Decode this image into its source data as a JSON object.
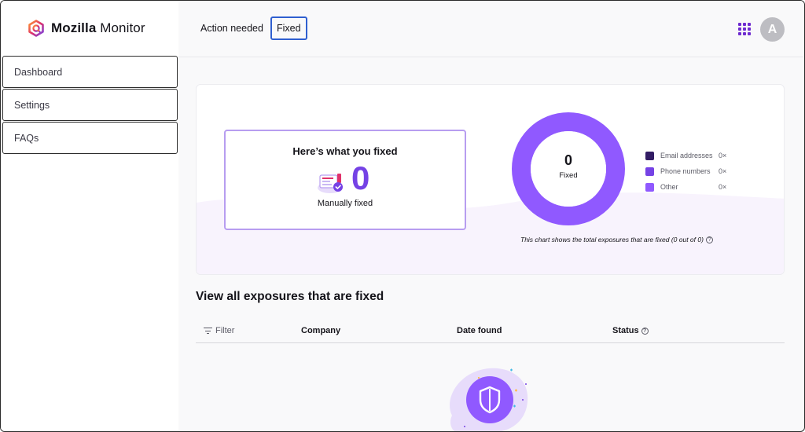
{
  "brand": {
    "name_bold": "Mozilla",
    "name_rest": " Monitor",
    "logo_icon": "mozilla-monitor-logo-icon"
  },
  "sidebar": {
    "items": [
      {
        "label": "Dashboard"
      },
      {
        "label": "Settings"
      },
      {
        "label": "FAQs"
      }
    ]
  },
  "header": {
    "tabs": [
      {
        "label": "Action needed",
        "selected": false
      },
      {
        "label": "Fixed",
        "selected": true
      }
    ],
    "apps_icon": "grid-apps-icon",
    "avatar_initial": "A"
  },
  "summary": {
    "title": "Here’s what you fixed",
    "count": "0",
    "count_label": "Manually fixed",
    "donut": {
      "value": "0",
      "label": "Fixed",
      "color": "#9059ff"
    },
    "legend": [
      {
        "label": "Email addresses",
        "count": "0×",
        "color": "#321c64"
      },
      {
        "label": "Phone numbers",
        "count": "0×",
        "color": "#7542e5"
      },
      {
        "label": "Other",
        "count": "0×",
        "color": "#9059ff"
      }
    ],
    "note": "This chart shows the total exposures that are fixed (0 out of 0)"
  },
  "exposures": {
    "title": "View all exposures that are fixed",
    "columns": {
      "filter": "Filter",
      "company": "Company",
      "date": "Date found",
      "status": "Status"
    }
  },
  "colors": {
    "accent": "#7542e5",
    "tab_focus": "#2f5fd0"
  }
}
